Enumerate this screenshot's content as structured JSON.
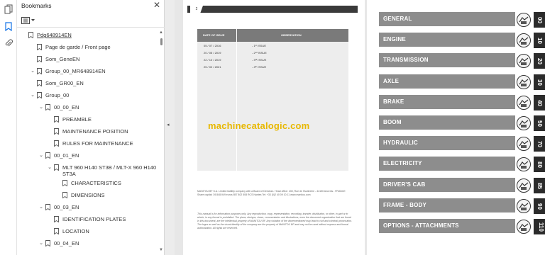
{
  "panel": {
    "title": "Bookmarks",
    "close_glyph": "✕",
    "options_icon": "bookmark-options-icon"
  },
  "rail": {
    "icons": [
      "page-thumbnails-icon",
      "bookmarks-icon",
      "attachments-icon"
    ]
  },
  "bookmarks": [
    {
      "label": "Pdg648914EN",
      "caret": "",
      "underline": true
    },
    {
      "label": "Page de garde / Front page",
      "caret": ""
    },
    {
      "label": "Som_GeneEN",
      "caret": ""
    },
    {
      "label": "Group_00_MR648914EN",
      "caret": "⌄"
    },
    {
      "label": "Som_GR00_EN",
      "caret": ""
    },
    {
      "label": "Group_00",
      "caret": "⌄"
    },
    {
      "label": "00_00_EN",
      "caret": "⌄"
    },
    {
      "label": "PREAMBLE",
      "caret": ""
    },
    {
      "label": "MAINTENANCE POSITION",
      "caret": ""
    },
    {
      "label": "RULES FOR MAINTENANCE",
      "caret": ""
    },
    {
      "label": "00_01_EN",
      "caret": "⌄"
    },
    {
      "label": "MLT 960 H140 ST3B / MLT-X 960 H140 ST3A",
      "caret": "⌄"
    },
    {
      "label": "CHARACTERISTICS",
      "caret": ""
    },
    {
      "label": "DIMENSIONS",
      "caret": ""
    },
    {
      "label": "00_03_EN",
      "caret": "⌄"
    },
    {
      "label": "IDENTIFICATION PLATES",
      "caret": ""
    },
    {
      "label": "LOCATION",
      "caret": ""
    },
    {
      "label": "00_04_EN",
      "caret": "⌄"
    }
  ],
  "viewer": {
    "collapse_glyph": "◂",
    "left_page": {
      "page_number": "2",
      "table_head": {
        "date": "DATE OF ISSUE",
        "observation": "OBSERVATION"
      },
      "issues": [
        {
          "date": "05 / 07 / 2016",
          "obs": "- 1ˢᵗ ISSUE"
        },
        {
          "date": "20 / 05 / 2019",
          "obs": "- 2ⁿᵈ ISSUE"
        },
        {
          "date": "22 / 10 / 2019",
          "obs": "- 3ʳᵈ ISSUE"
        },
        {
          "date": "25 / 02 / 2021",
          "obs": "- 4ᵗʰ ISSUE"
        }
      ],
      "watermark": "machinecatalogic.com",
      "company_text": "MANITOU BF S.A. Limited liability company with a Board of Directors. Head office: 430, Rue de l'Aubinière - 44150 Ancenis - FRANCE Share capital: 39,548,949 euros 857 802 508 RCS Nantes Tel: +33 (0)2 40 09 10 11 www.manitou.com",
      "legal_text": "This manual is for information purposes only. Any reproduction, copy, representation, recording, transfer, distribution, or other, in part or in whole, in any format is prohibited. The plans, designs, views, commentaries and illustrations, even the document organization that are found in this document, are the intellectual property of MANITOU BF. Any violation of the aforementioned may lead to civil and criminal prosecution. The logos as well as the visual identity of the company are the property of MANITOU BF and may not be used without express and formal authorization. All rights are reserved."
    },
    "chapters": [
      {
        "label": "GENERAL",
        "num": "00",
        "icon": "general-icon"
      },
      {
        "label": "ENGINE",
        "num": "10",
        "icon": "engine-icon"
      },
      {
        "label": "TRANSMISSION",
        "num": "20",
        "icon": "transmission-icon"
      },
      {
        "label": "AXLE",
        "num": "30",
        "icon": "axle-icon"
      },
      {
        "label": "BRAKE",
        "num": "40",
        "icon": "brake-icon"
      },
      {
        "label": "BOOM",
        "num": "50",
        "icon": "boom-icon"
      },
      {
        "label": "HYDRAULIC",
        "num": "70",
        "icon": "hydraulic-icon"
      },
      {
        "label": "ELECTRICITY",
        "num": "80",
        "icon": "electricity-icon"
      },
      {
        "label": "DRIVER'S CAB",
        "num": "85",
        "icon": "drivers-cab-icon"
      },
      {
        "label": "FRAME - BODY",
        "num": "90",
        "icon": "frame-body-icon"
      },
      {
        "label": "OPTIONS - ATTACHMENTS",
        "num": "110",
        "icon": "options-attachments-icon"
      }
    ]
  }
}
